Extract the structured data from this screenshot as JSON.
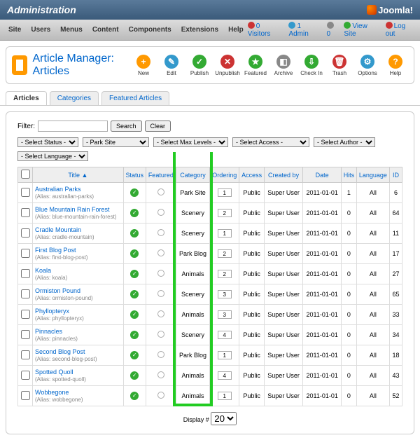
{
  "header": {
    "title": "Administration",
    "brand": "Joomla!"
  },
  "menu": [
    "Site",
    "Users",
    "Menus",
    "Content",
    "Components",
    "Extensions",
    "Help"
  ],
  "status": {
    "visitors": "0 Visitors",
    "admin": "1 Admin",
    "mail": "0",
    "viewsite": "View Site",
    "logout": "Log out"
  },
  "page": {
    "title": "Article Manager: Articles"
  },
  "toolbar": [
    {
      "label": "New",
      "color": "#f90",
      "glyph": "+"
    },
    {
      "label": "Edit",
      "color": "#39c",
      "glyph": "✎"
    },
    {
      "label": "Publish",
      "color": "#3a3",
      "glyph": "✓"
    },
    {
      "label": "Unpublish",
      "color": "#c33",
      "glyph": "✕"
    },
    {
      "label": "Featured",
      "color": "#3a3",
      "glyph": "★"
    },
    {
      "label": "Archive",
      "color": "#888",
      "glyph": "◧"
    },
    {
      "label": "Check In",
      "color": "#3a3",
      "glyph": "⇩"
    },
    {
      "label": "Trash",
      "color": "#c33",
      "glyph": "🗑"
    },
    {
      "label": "Options",
      "color": "#39c",
      "glyph": "⚙"
    },
    {
      "label": "Help",
      "color": "#f90",
      "glyph": "?"
    }
  ],
  "tabs": [
    "Articles",
    "Categories",
    "Featured Articles"
  ],
  "filter": {
    "label": "Filter:",
    "search": "Search",
    "clear": "Clear"
  },
  "selects": {
    "status": "- Select Status -",
    "category": "- Park Site",
    "levels": "- Select Max Levels -",
    "access": "- Select Access -",
    "author": "- Select Author -",
    "language": "- Select Language -"
  },
  "columns": [
    "",
    "Title ▲",
    "Status",
    "Featured",
    "Category",
    "Ordering",
    "Access",
    "Created by",
    "Date",
    "Hits",
    "Language",
    "ID"
  ],
  "rows": [
    {
      "title": "Australian Parks",
      "alias": "australian-parks",
      "cat": "Park Site",
      "ord": "1",
      "acc": "Public",
      "by": "Super User",
      "date": "2011-01-01",
      "hits": "1",
      "lang": "All",
      "id": "6"
    },
    {
      "title": "Blue Mountain Rain Forest",
      "alias": "blue-mountain-rain-forest",
      "cat": "Scenery",
      "ord": "2",
      "acc": "Public",
      "by": "Super User",
      "date": "2011-01-01",
      "hits": "0",
      "lang": "All",
      "id": "64"
    },
    {
      "title": "Cradle Mountain",
      "alias": "cradle-mountain",
      "cat": "Scenery",
      "ord": "1",
      "acc": "Public",
      "by": "Super User",
      "date": "2011-01-01",
      "hits": "0",
      "lang": "All",
      "id": "11"
    },
    {
      "title": "First Blog Post",
      "alias": "first-blog-post",
      "cat": "Park Blog",
      "ord": "2",
      "acc": "Public",
      "by": "Super User",
      "date": "2011-01-01",
      "hits": "0",
      "lang": "All",
      "id": "17"
    },
    {
      "title": "Koala",
      "alias": "koala",
      "cat": "Animals",
      "ord": "2",
      "acc": "Public",
      "by": "Super User",
      "date": "2011-01-01",
      "hits": "0",
      "lang": "All",
      "id": "27"
    },
    {
      "title": "Ormiston Pound",
      "alias": "ormiston-pound",
      "cat": "Scenery",
      "ord": "3",
      "acc": "Public",
      "by": "Super User",
      "date": "2011-01-01",
      "hits": "0",
      "lang": "All",
      "id": "65"
    },
    {
      "title": "Phyllopteryx",
      "alias": "phyllopteryx",
      "cat": "Animals",
      "ord": "3",
      "acc": "Public",
      "by": "Super User",
      "date": "2011-01-01",
      "hits": "0",
      "lang": "All",
      "id": "33"
    },
    {
      "title": "Pinnacles",
      "alias": "pinnacles",
      "cat": "Scenery",
      "ord": "4",
      "acc": "Public",
      "by": "Super User",
      "date": "2011-01-01",
      "hits": "0",
      "lang": "All",
      "id": "34"
    },
    {
      "title": "Second Blog Post",
      "alias": "second-blog-post",
      "cat": "Park Blog",
      "ord": "1",
      "acc": "Public",
      "by": "Super User",
      "date": "2011-01-01",
      "hits": "0",
      "lang": "All",
      "id": "18"
    },
    {
      "title": "Spotted Quoll",
      "alias": "spotted-quoll",
      "cat": "Animals",
      "ord": "4",
      "acc": "Public",
      "by": "Super User",
      "date": "2011-01-01",
      "hits": "0",
      "lang": "All",
      "id": "43"
    },
    {
      "title": "Wobbegone",
      "alias": "wobbegone",
      "cat": "Animals",
      "ord": "1",
      "acc": "Public",
      "by": "Super User",
      "date": "2011-01-01",
      "hits": "0",
      "lang": "All",
      "id": "52"
    }
  ],
  "footer": {
    "display": "Display #",
    "value": "20"
  }
}
